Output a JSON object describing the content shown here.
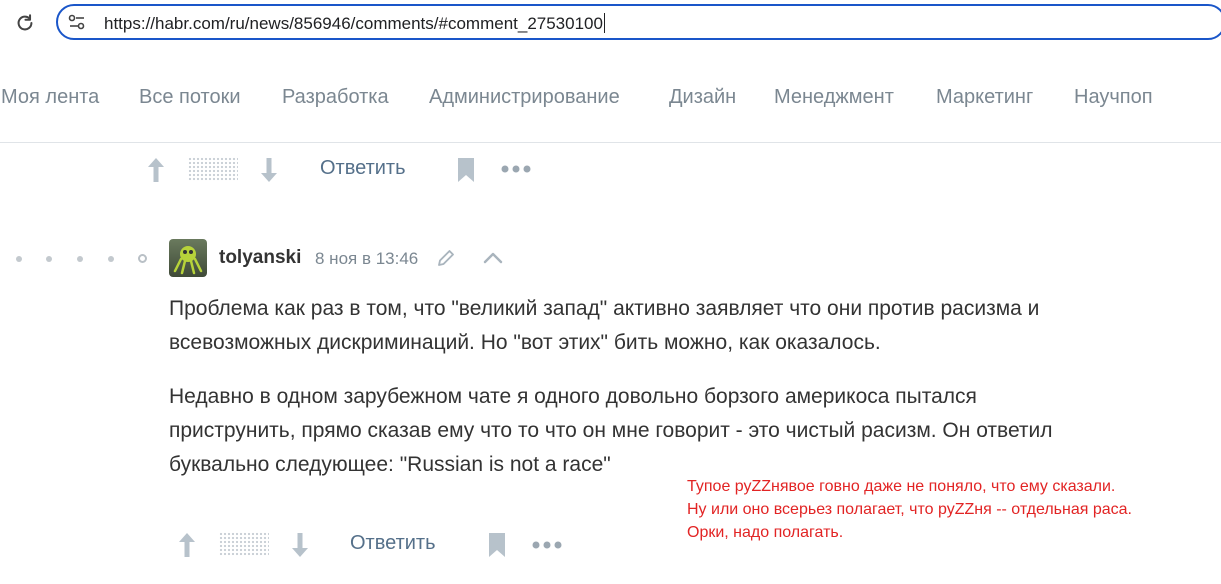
{
  "browser": {
    "url": "https://habr.com/ru/news/856946/comments/#comment_27530100"
  },
  "nav": {
    "items": [
      {
        "label": "Моя лента"
      },
      {
        "label": "Все потоки"
      },
      {
        "label": "Разработка"
      },
      {
        "label": "Администрирование"
      },
      {
        "label": "Дизайн"
      },
      {
        "label": "Менеджмент"
      },
      {
        "label": "Маркетинг"
      },
      {
        "label": "Научпоп"
      }
    ]
  },
  "prev_comment_actions": {
    "reply_label": "Ответить"
  },
  "comment": {
    "username": "tolyanski",
    "timestamp": "8 ноя в 13:46",
    "paragraphs": [
      {
        "line1": "Проблема как раз в том, что \"великий запад\" активно заявляет что они против расизма и",
        "line2": "всевозможных дискриминаций. Но \"вот этих\" бить можно, как оказалось."
      },
      {
        "line1": "Недавно в одном зарубежном чате я одного довольно борзого америкоса пытался",
        "line2": "приструнить, прямо сказав ему что то что он мне говорит - это чистый расизм. Он ответил",
        "line3": "буквально следующее: \"Russian is not a race\""
      }
    ],
    "actions": {
      "reply_label": "Ответить"
    }
  },
  "annotation": {
    "line1": "Тупое руZZнявое говно даже не поняло, что ему сказали.",
    "line2": "Ну или оно всерьез полагает, что руZZня -- отдельная раса.",
    "line3": "Орки, надо полагать."
  },
  "colors": {
    "address_border": "#1a56c9",
    "nav_text": "#7b8791",
    "reply_text": "#55708a",
    "annotation": "#e22424"
  }
}
